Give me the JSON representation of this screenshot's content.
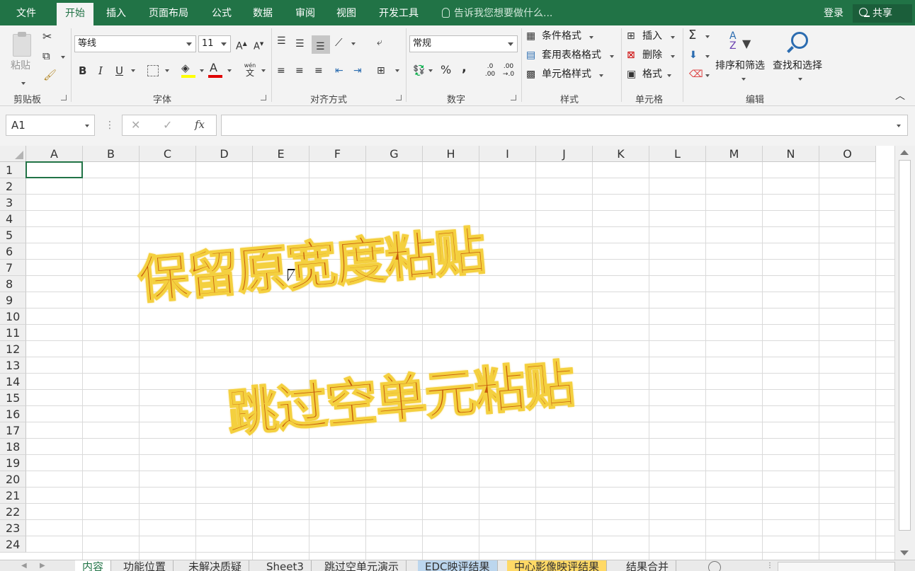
{
  "menu": {
    "tabs": [
      "文件",
      "开始",
      "插入",
      "页面布局",
      "公式",
      "数据",
      "审阅",
      "视图",
      "开发工具"
    ],
    "active_tab": "开始",
    "tell_me": "告诉我您想要做什么...",
    "login": "登录",
    "share": "共享"
  },
  "ribbon": {
    "clipboard": {
      "paste": "粘贴",
      "label": "剪贴板"
    },
    "font": {
      "name": "等线",
      "size": "11",
      "grow": "A",
      "shrink": "A",
      "bold": "B",
      "italic": "I",
      "underline": "U",
      "phonetic_top": "wén",
      "phonetic_bottom": "文",
      "font_color_letter": "A",
      "label": "字体"
    },
    "alignment": {
      "label": "对齐方式"
    },
    "number": {
      "format": "常规",
      "percent": "%",
      "comma": ",",
      "inc_top": ".0",
      "inc_bottom": ".00",
      "dec_top": ".00",
      "dec_bottom": "→.0",
      "label": "数字"
    },
    "styles": {
      "conditional": "条件格式",
      "table": "套用表格格式",
      "cell": "单元格样式",
      "label": "样式"
    },
    "cells": {
      "insert": "插入",
      "delete": "删除",
      "format": "格式",
      "label": "单元格"
    },
    "editing": {
      "sigma": "Σ",
      "sort_az": "A",
      "sort_z": "Z",
      "sort": "排序和筛选",
      "find": "查找和选择",
      "label": "编辑"
    }
  },
  "formula_bar": {
    "name_box": "A1",
    "cancel": "✕",
    "enter": "✓",
    "fx": "fx",
    "value": ""
  },
  "grid": {
    "columns": [
      "A",
      "B",
      "C",
      "D",
      "E",
      "F",
      "G",
      "H",
      "I",
      "J",
      "K",
      "L",
      "M",
      "N",
      "O"
    ],
    "rows": [
      "1",
      "2",
      "3",
      "4",
      "5",
      "6",
      "7",
      "8",
      "9",
      "10",
      "11",
      "12",
      "13",
      "14",
      "15",
      "16",
      "17",
      "18",
      "19",
      "20",
      "21",
      "22",
      "23",
      "24"
    ]
  },
  "overlay": {
    "line1": "保留原宽度粘贴",
    "line2": "跳过空单元粘贴",
    "text_color": "#c65a0c",
    "outline_color": "#f4d03f"
  },
  "sheets": {
    "tabs": [
      "内容",
      "功能位置",
      "未解决质疑",
      "Sheet3",
      "跳过空单元演示",
      "EDC映评结果",
      "中心影像映评结果",
      "结果合并"
    ],
    "active": "内容",
    "tab_colors": {
      "EDC映评结果": "#bcd6ee",
      "中心影像映评结果": "#ffd966"
    }
  },
  "colors": {
    "accent": "#217346",
    "ribbon_bg": "#f3f3f3"
  }
}
